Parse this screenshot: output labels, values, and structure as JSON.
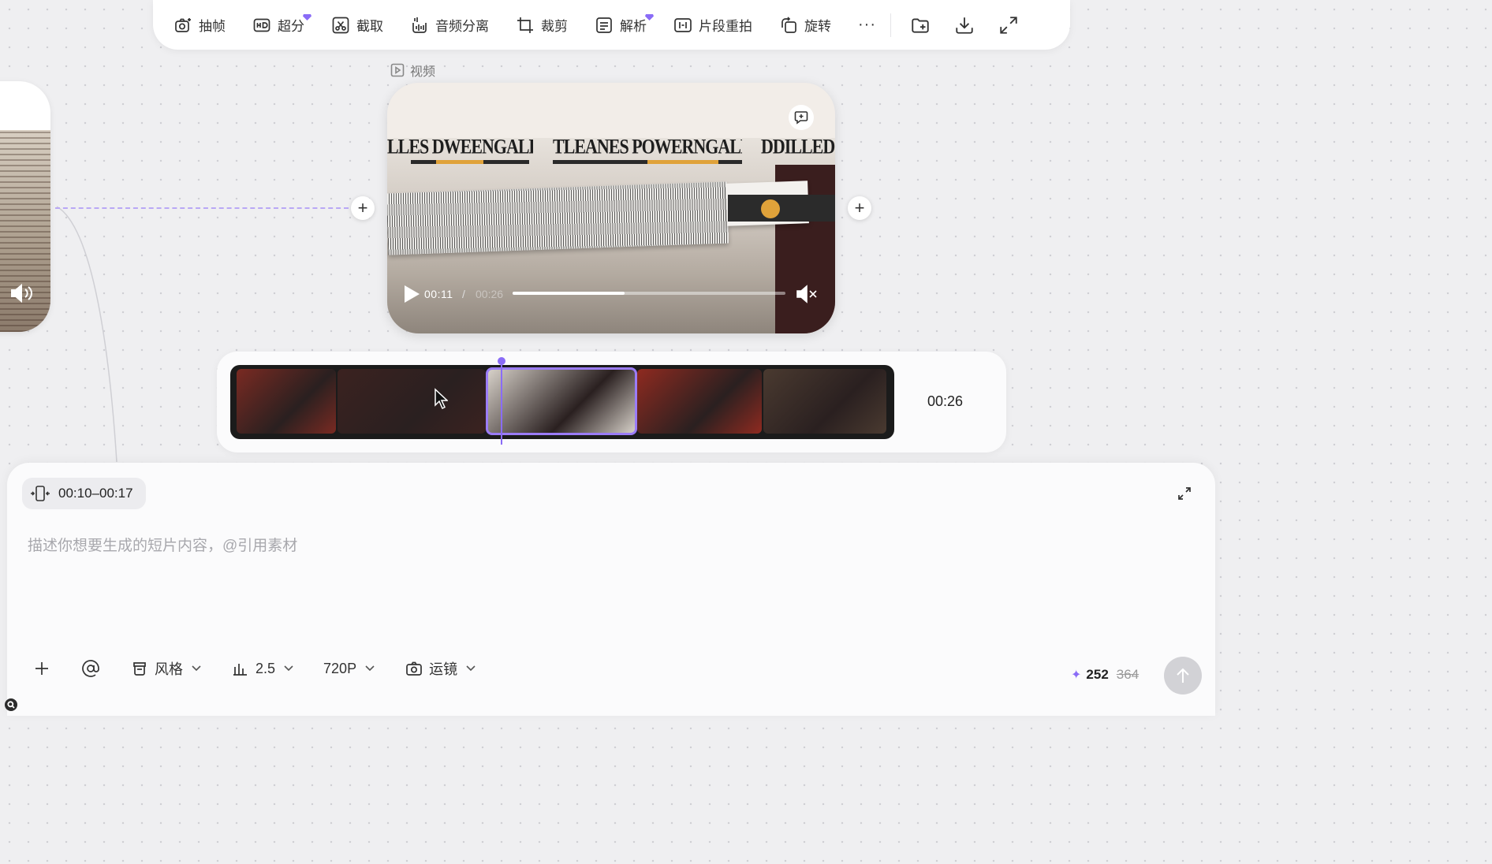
{
  "toolbar": {
    "items": [
      {
        "label": "抽帧",
        "icon": "camera-plus-icon",
        "premium": false
      },
      {
        "label": "超分",
        "icon": "hd-icon",
        "premium": true
      },
      {
        "label": "截取",
        "icon": "cut-icon",
        "premium": false
      },
      {
        "label": "音频分离",
        "icon": "audio-split-icon",
        "premium": false
      },
      {
        "label": "裁剪",
        "icon": "crop-icon",
        "premium": false
      },
      {
        "label": "解析",
        "icon": "analyze-icon",
        "premium": true
      },
      {
        "label": "片段重拍",
        "icon": "segment-reshoot-icon",
        "premium": false
      },
      {
        "label": "旋转",
        "icon": "rotate-icon",
        "premium": false
      }
    ],
    "more_label": "···",
    "icons": [
      "add-folder-icon",
      "download-icon",
      "fullscreen-icon"
    ]
  },
  "video": {
    "label": "视频",
    "current_time": "00:11",
    "separator": "/",
    "total_time": "00:26",
    "progress": 0.41,
    "muted": true
  },
  "timeline": {
    "duration": "00:26",
    "selected_index": 2,
    "playhead_fraction": 0.41,
    "thumbnails": [
      {
        "name": "clip-1",
        "color": "#7a2a22"
      },
      {
        "name": "clip-2",
        "color": "#3b2220"
      },
      {
        "name": "clip-3",
        "color": "#d9d3cb"
      },
      {
        "name": "clip-4",
        "color": "#8f2a20"
      },
      {
        "name": "clip-5",
        "color": "#4a3a30"
      }
    ]
  },
  "prompt": {
    "range": "00:10–00:17",
    "placeholder": "描述你想要生成的短片内容，@引用素材",
    "value": ""
  },
  "bottom_bar": {
    "style_label": "风格",
    "model_label": "2.5",
    "resolution_label": "720P",
    "camera_label": "运镜"
  },
  "credits": {
    "current": "252",
    "original": "364"
  },
  "colors": {
    "accent": "#8a6cf7",
    "dashed_line": "#b9a8f5"
  }
}
